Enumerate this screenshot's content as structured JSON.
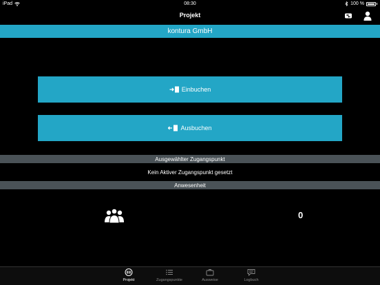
{
  "status_bar": {
    "device": "iPad",
    "time": "08:30",
    "battery": "100 %"
  },
  "nav": {
    "title": "Projekt"
  },
  "company": {
    "name": "kontura GmbH"
  },
  "actions": {
    "check_in_label": "Einbuchen",
    "check_out_label": "Ausbuchen"
  },
  "access_point": {
    "header": "Ausgewählter Zugangspunkt",
    "status": "Kein Aktiver Zugangspunkt gesetzt"
  },
  "attendance": {
    "header": "Anwesenheit",
    "count": "0"
  },
  "tabs": [
    {
      "label": "Projekt",
      "icon": "projekt-icon",
      "active": true
    },
    {
      "label": "Zugangspunkte",
      "icon": "list-icon",
      "active": false
    },
    {
      "label": "Ausweise",
      "icon": "id-card-icon",
      "active": false
    },
    {
      "label": "Logbuch",
      "icon": "chat-icon",
      "active": false
    }
  ],
  "colors": {
    "accent": "#23a6c6",
    "section_header": "#4a5257",
    "background": "#000000"
  }
}
